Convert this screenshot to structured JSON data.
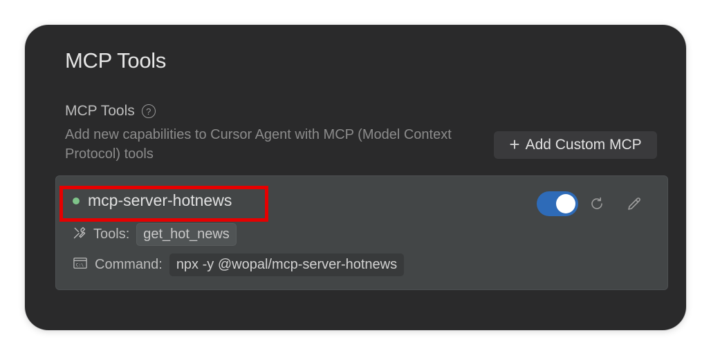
{
  "page": {
    "title": "MCP Tools"
  },
  "section": {
    "title": "MCP Tools",
    "help_icon": "question-circle-icon",
    "description": "Add new capabilities to Cursor Agent with MCP (Model Context Protocol) tools"
  },
  "add_button": {
    "icon": "plus-icon",
    "label": "Add Custom MCP"
  },
  "server": {
    "name": "mcp-server-hotnews",
    "status": "active",
    "status_color": "#7fc48a",
    "enabled": true,
    "toggle_color": "#2e6bb8",
    "tools_label": "Tools:",
    "tools": [
      "get_hot_news"
    ],
    "command_label": "Command:",
    "command": "npx -y @wopal/mcp-server-hotnews",
    "actions": [
      "refresh-icon",
      "edit-pencil-icon"
    ]
  },
  "annotation": {
    "highlight_color": "#e60000"
  }
}
